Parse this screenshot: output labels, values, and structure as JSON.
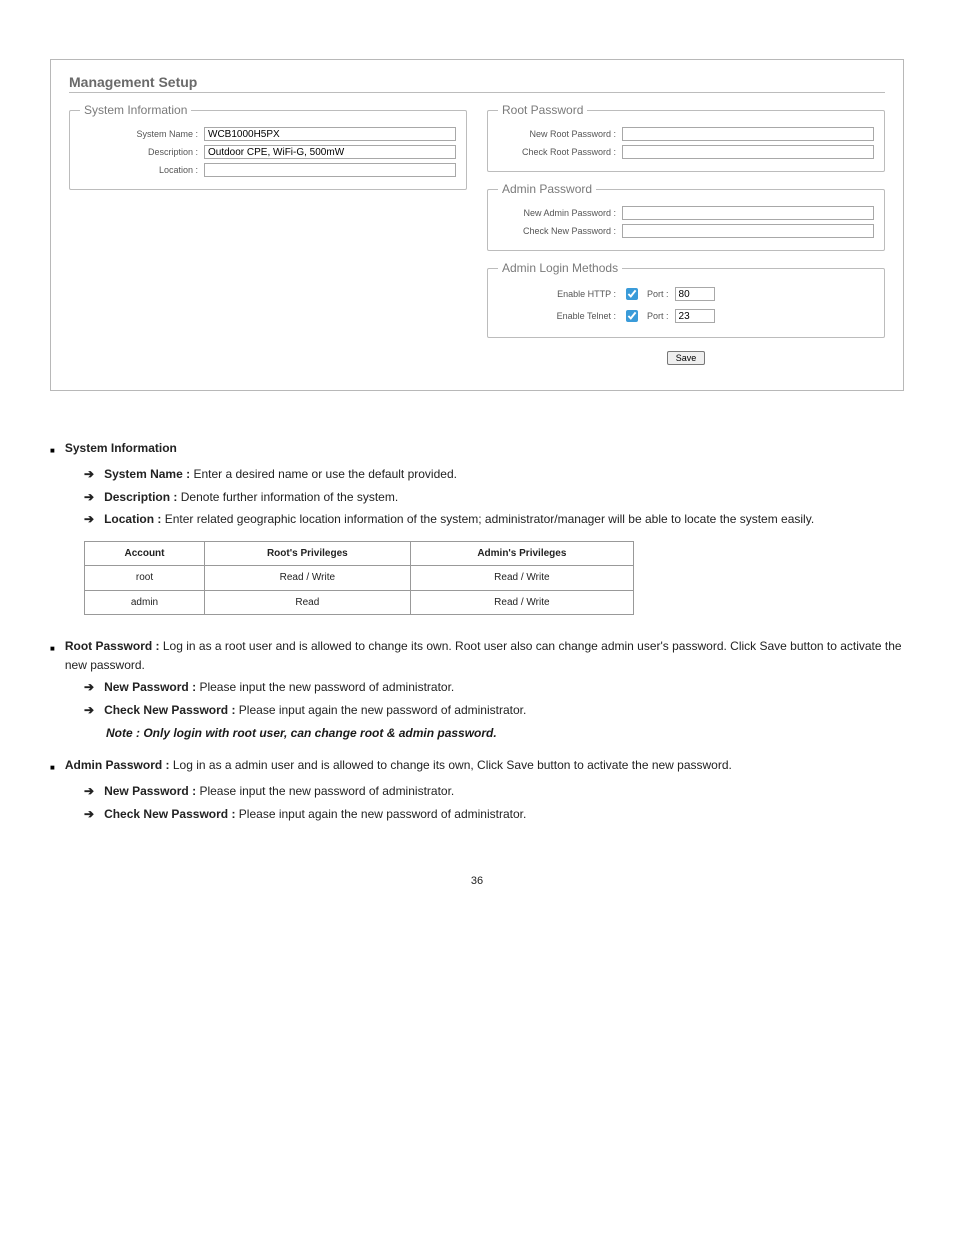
{
  "panel": {
    "title": "Management Setup",
    "sysInfo": {
      "legend": "System Information",
      "nameLabel": "System Name :",
      "nameValue": "WCB1000H5PX",
      "descLabel": "Description :",
      "descValue": "Outdoor CPE, WiFi-G, 500mW",
      "locationLabel": "Location :",
      "locationValue": ""
    },
    "rootPw": {
      "legend": "Root Password",
      "newLabel": "New Root Password :",
      "checkLabel": "Check Root Password :"
    },
    "adminPw": {
      "legend": "Admin Password",
      "newLabel": "New Admin Password :",
      "checkLabel": "Check New Password :"
    },
    "login": {
      "legend": "Admin Login Methods",
      "httpLabel": "Enable HTTP :",
      "httpPortLabel": "Port :",
      "httpPortValue": "80",
      "telnetLabel": "Enable Telnet :",
      "telnetPortLabel": "Port :",
      "telnetPortValue": "23"
    },
    "saveLabel": "Save"
  },
  "sec1": {
    "heading": "System Information",
    "items": {
      "nameTitle": "System Name :",
      "nameBody": "Enter a desired name or use the default provided.",
      "descTitle": "Description :",
      "descBody": "Denote further information of the system.",
      "locTitle": "Location :",
      "locBody": "Enter related geographic location information of the system; administrator/manager will be able to locate the system easily."
    }
  },
  "sec2": {
    "heading": "Root Password :",
    "headingBody": "Log in as a root user and is allowed to change its own. Root user also can change admin user's password. Click Save button to activate the new password.",
    "items": {
      "newTitle": "New Password :",
      "newBody": "Please input the new password of administrator.",
      "checkTitle": "Check New Password :",
      "checkBody": "Please input again the new password of administrator."
    },
    "note": "Note : Only login with root user, can change root & admin password."
  },
  "sec3": {
    "heading": "Admin Password :",
    "headingBody": "Log in as a admin user and is allowed to change its own, Click Save button to activate the new password.",
    "items": {
      "newTitle": "New Password :",
      "newBody": "Please input the new password of administrator.",
      "checkTitle": "Check New Password :",
      "checkBody": "Please input again the new password of administrator."
    }
  },
  "table": {
    "h1": "Account",
    "h2": "Root's Privileges",
    "h3": "Admin's Privileges",
    "r1c1": "root",
    "r1c2": "Read / Write",
    "r1c3": "Read / Write",
    "r2c1": "admin",
    "r2c2": "Read",
    "r2c3": "Read / Write"
  },
  "pagenum": "36"
}
